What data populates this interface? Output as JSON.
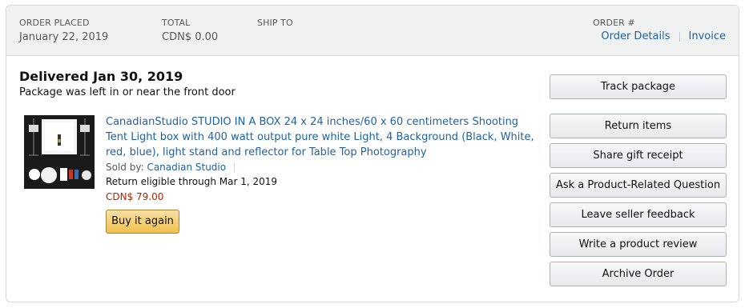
{
  "header": {
    "order_placed_label": "ORDER PLACED",
    "order_placed_value": "January 22, 2019",
    "total_label": "TOTAL",
    "total_value": "CDN$ 0.00",
    "ship_to_label": "SHIP TO",
    "order_number_label": "ORDER #",
    "order_details_link": "Order Details",
    "invoice_link": "Invoice"
  },
  "shipment": {
    "status_title": "Delivered Jan 30, 2019",
    "status_note": "Package was left in or near the front door"
  },
  "item": {
    "image_icon": "product-photo",
    "title": "CanadianStudio STUDIO IN A BOX 24 x 24 inches/60 x 60 centimeters Shooting Tent Light box with 400 watt output pure white Light, 4 Background (Black, White, red, blue), light stand and reflector for Table Top Photography",
    "sold_by_label": "Sold by:",
    "seller": "Canadian Studio",
    "return_eligibility": "Return eligible through Mar 1, 2019",
    "price": "CDN$ 79.00",
    "buy_again_label": "Buy it again"
  },
  "actions": {
    "track_package": "Track package",
    "return_items": "Return items",
    "share_gift_receipt": "Share gift receipt",
    "ask_question": "Ask a Product-Related Question",
    "seller_feedback": "Leave seller feedback",
    "product_review": "Write a product review",
    "archive_order": "Archive Order"
  },
  "colors": {
    "link": "#2162a1",
    "price": "#b12704",
    "header_bg": "#f0f2f2",
    "buy_button": "#f0c14b"
  }
}
